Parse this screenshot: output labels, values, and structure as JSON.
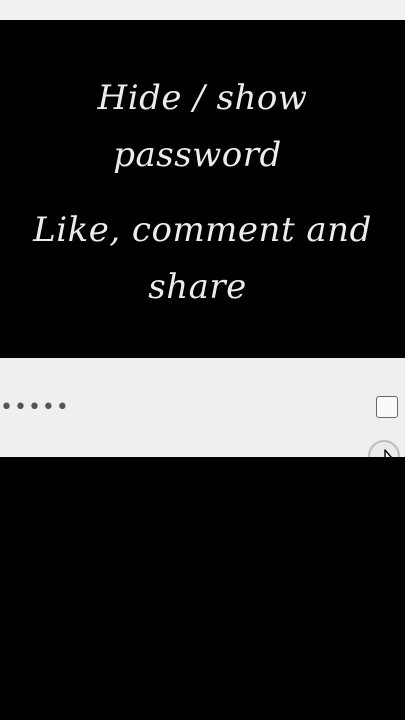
{
  "caption": {
    "line1": "Hide / show",
    "line2": "password",
    "line3": "Like, comment and",
    "line4": "share"
  },
  "password_field": {
    "masked_value": "•••••"
  },
  "colors": {
    "background": "#000000",
    "panel": "#efefef",
    "caption_text": "#ececec"
  },
  "icons": {
    "cursor": "mouse-pointer-icon"
  }
}
